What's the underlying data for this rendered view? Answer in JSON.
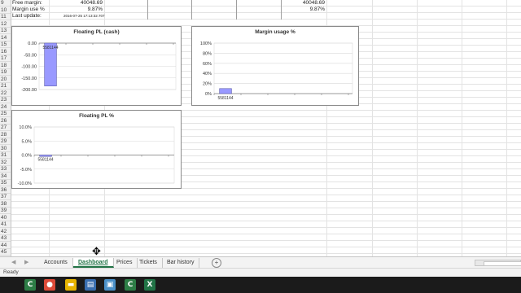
{
  "cells": {
    "free_margin_label": "Free margin:",
    "free_margin_value": "40048.69",
    "free_margin_value_right": "40048.69",
    "margin_use_label": "Margin use %",
    "margin_use_value": "9.87%",
    "margin_use_value_right": "9.87%",
    "last_update_label": "Last update:",
    "last_update_value": "2016-07-25 17:13:32.707"
  },
  "row_numbers": [
    "9",
    "10",
    "11",
    "12",
    "13",
    "14",
    "15",
    "16",
    "17",
    "18",
    "19",
    "20",
    "21",
    "22",
    "23",
    "24",
    "25",
    "26",
    "27",
    "28",
    "29",
    "30",
    "31",
    "32",
    "33",
    "34",
    "35",
    "36",
    "37",
    "38",
    "39",
    "40",
    "41",
    "42",
    "43",
    "44",
    "45"
  ],
  "chart_data": [
    {
      "type": "bar",
      "title": "Floating PL (cash)",
      "categories": [
        "5581144"
      ],
      "values": [
        -185
      ],
      "ylim": [
        -200,
        0
      ],
      "yticks": [
        "0.00",
        "-50.00",
        "-100.00",
        "-150.00",
        "-200.00"
      ],
      "color": "#9999ff"
    },
    {
      "type": "bar",
      "title": "Margin usage %",
      "categories": [
        "5581144"
      ],
      "values": [
        0.1
      ],
      "ylim": [
        0,
        1
      ],
      "yticks": [
        "100%",
        "80%",
        "60%",
        "40%",
        "20%",
        "0%"
      ],
      "color": "#9999ff"
    },
    {
      "type": "bar",
      "title": "Floating PL %",
      "categories": [
        "5581144"
      ],
      "values": [
        -0.5
      ],
      "ylim": [
        -10,
        10
      ],
      "yticks": [
        "10.0%",
        "5.0%",
        "0.0%",
        "-5.0%",
        "-10.0%"
      ],
      "color": "#9999ff"
    }
  ],
  "tabs": [
    {
      "label": "Accounts",
      "active": false
    },
    {
      "label": "Dashboard",
      "active": true
    },
    {
      "label": "Prices",
      "active": false
    },
    {
      "label": "Tickets",
      "active": false
    },
    {
      "label": "Bar history",
      "active": false
    }
  ],
  "add_sheet_label": "+",
  "status": {
    "text": "Ready"
  },
  "taskbar": [
    {
      "icon": "start-icon",
      "glyph": "C",
      "color": "#2d7d46"
    },
    {
      "icon": "chrome-icon",
      "glyph": "●",
      "color": "#dd4b39"
    },
    {
      "icon": "file-explorer-icon",
      "glyph": "▬",
      "color": "#e6b400"
    },
    {
      "icon": "notepad-icon",
      "glyph": "▤",
      "color": "#3a6fb0"
    },
    {
      "icon": "remote-desktop-icon",
      "glyph": "▣",
      "color": "#4a90c8"
    },
    {
      "icon": "app-icon-c",
      "glyph": "C",
      "color": "#2d7d46"
    },
    {
      "icon": "excel-icon",
      "glyph": "X",
      "color": "#217346"
    }
  ]
}
